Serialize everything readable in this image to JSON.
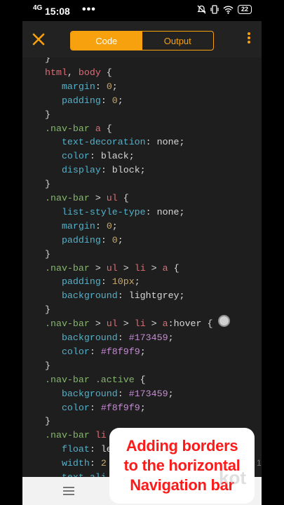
{
  "status_bar": {
    "network": "4G",
    "time": "15:08",
    "dots": "•••",
    "battery": "22"
  },
  "toolbar": {
    "tabs": [
      {
        "label": "Code",
        "active": true
      },
      {
        "label": "Output",
        "active": false
      }
    ]
  },
  "accent_color": "#f7a10f",
  "code_lines": [
    [
      [
        "}",
        "p"
      ]
    ],
    [
      [
        "html",
        "tag"
      ],
      [
        ", ",
        "p"
      ],
      [
        "body",
        "tag"
      ],
      [
        " {",
        "p"
      ]
    ],
    [
      [
        "   ",
        "p"
      ],
      [
        "margin",
        "prop"
      ],
      [
        ": ",
        "p"
      ],
      [
        "0",
        "num"
      ],
      [
        ";",
        "p"
      ]
    ],
    [
      [
        "   ",
        "p"
      ],
      [
        "padding",
        "prop"
      ],
      [
        ": ",
        "p"
      ],
      [
        "0",
        "num"
      ],
      [
        ";",
        "p"
      ]
    ],
    [
      [
        "}",
        "p"
      ]
    ],
    [
      [
        ".nav-bar",
        "sel"
      ],
      [
        " ",
        "p"
      ],
      [
        "a",
        "tag"
      ],
      [
        " {",
        "p"
      ]
    ],
    [
      [
        "   ",
        "p"
      ],
      [
        "text-decoration",
        "prop"
      ],
      [
        ": none;",
        "p"
      ]
    ],
    [
      [
        "   ",
        "p"
      ],
      [
        "color",
        "prop"
      ],
      [
        ": black;",
        "p"
      ]
    ],
    [
      [
        "   ",
        "p"
      ],
      [
        "display",
        "prop"
      ],
      [
        ": block;",
        "p"
      ]
    ],
    [
      [
        "}",
        "p"
      ]
    ],
    [
      [
        ".nav-bar",
        "sel"
      ],
      [
        " > ",
        "p"
      ],
      [
        "ul",
        "tag"
      ],
      [
        " {",
        "p"
      ]
    ],
    [
      [
        "   ",
        "p"
      ],
      [
        "list-style-type",
        "prop"
      ],
      [
        ": none;",
        "p"
      ]
    ],
    [
      [
        "   ",
        "p"
      ],
      [
        "margin",
        "prop"
      ],
      [
        ": ",
        "p"
      ],
      [
        "0",
        "num"
      ],
      [
        ";",
        "p"
      ]
    ],
    [
      [
        "   ",
        "p"
      ],
      [
        "padding",
        "prop"
      ],
      [
        ": ",
        "p"
      ],
      [
        "0",
        "num"
      ],
      [
        ";",
        "p"
      ]
    ],
    [
      [
        "}",
        "p"
      ]
    ],
    [
      [
        ".nav-bar",
        "sel"
      ],
      [
        " > ",
        "p"
      ],
      [
        "ul",
        "tag"
      ],
      [
        " > ",
        "p"
      ],
      [
        "li",
        "tag"
      ],
      [
        " > ",
        "p"
      ],
      [
        "a",
        "tag"
      ],
      [
        " {",
        "p"
      ]
    ],
    [
      [
        "   ",
        "p"
      ],
      [
        "padding",
        "prop"
      ],
      [
        ": ",
        "p"
      ],
      [
        "10px",
        "num"
      ],
      [
        ";",
        "p"
      ]
    ],
    [
      [
        "   ",
        "p"
      ],
      [
        "background",
        "prop"
      ],
      [
        ": lightgrey;",
        "p"
      ]
    ],
    [
      [
        "}",
        "p"
      ]
    ],
    [
      [
        ".nav-bar",
        "sel"
      ],
      [
        " > ",
        "p"
      ],
      [
        "ul",
        "tag"
      ],
      [
        " > ",
        "p"
      ],
      [
        "li",
        "tag"
      ],
      [
        " > ",
        "p"
      ],
      [
        "a",
        "tag"
      ],
      [
        ":hover {",
        "p"
      ]
    ],
    [
      [
        "   ",
        "p"
      ],
      [
        "background",
        "prop"
      ],
      [
        ": ",
        "p"
      ],
      [
        "#173459",
        "hex"
      ],
      [
        ";",
        "p"
      ]
    ],
    [
      [
        "   ",
        "p"
      ],
      [
        "color",
        "prop"
      ],
      [
        ": ",
        "p"
      ],
      [
        "#f8f9f9",
        "hex"
      ],
      [
        ";",
        "p"
      ]
    ],
    [
      [
        "}",
        "p"
      ]
    ],
    [
      [
        ".nav-bar",
        "sel"
      ],
      [
        " ",
        "p"
      ],
      [
        ".active",
        "sel"
      ],
      [
        " {",
        "p"
      ]
    ],
    [
      [
        "   ",
        "p"
      ],
      [
        "background",
        "prop"
      ],
      [
        ": ",
        "p"
      ],
      [
        "#173459",
        "hex"
      ],
      [
        ";",
        "p"
      ]
    ],
    [
      [
        "   ",
        "p"
      ],
      [
        "color",
        "prop"
      ],
      [
        ": ",
        "p"
      ],
      [
        "#f8f9f9",
        "hex"
      ],
      [
        ";",
        "p"
      ]
    ],
    [
      [
        "}",
        "p"
      ]
    ],
    [
      [
        ".nav-bar",
        "sel"
      ],
      [
        " ",
        "p"
      ],
      [
        "li",
        "tag"
      ]
    ],
    [
      [
        "   ",
        "p"
      ],
      [
        "float",
        "prop"
      ],
      [
        ": le",
        "p"
      ]
    ],
    [
      [
        "   ",
        "p"
      ],
      [
        "width",
        "prop"
      ],
      [
        ": ",
        "p"
      ],
      [
        "2",
        "num"
      ]
    ],
    [
      [
        "   ",
        "p"
      ],
      [
        "text-ali",
        "prop"
      ]
    ]
  ],
  "caption": {
    "lines": [
      "Adding borders",
      "to the horizontal",
      "Navigation bar"
    ]
  },
  "watermark": "kot",
  "side_mark": "1"
}
